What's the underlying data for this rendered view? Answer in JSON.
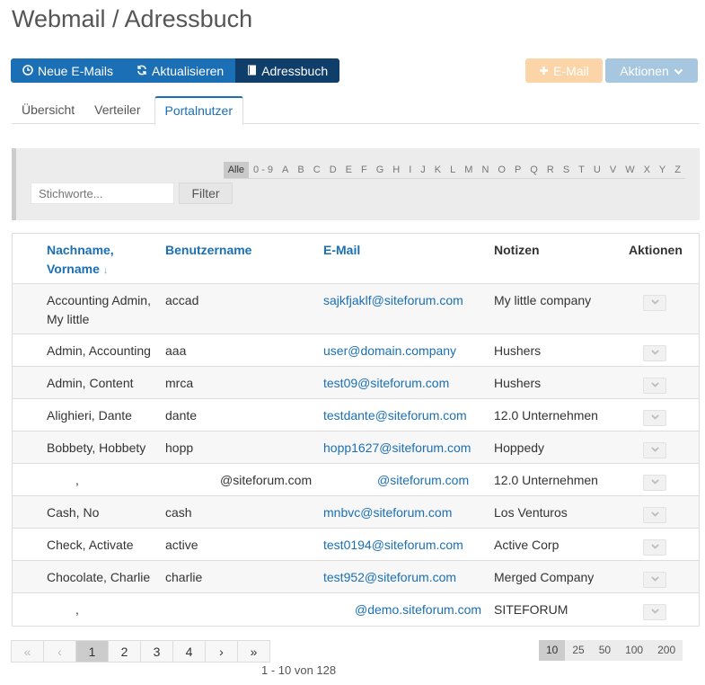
{
  "title": "Webmail / Adressbuch",
  "toolbar": {
    "new_mails": "Neue E-Mails",
    "refresh": "Aktualisieren",
    "addressbook": "Adressbuch",
    "email": "E-Mail",
    "actions": "Aktionen"
  },
  "tabs": [
    "Übersicht",
    "Verteiler",
    "Portalnutzer"
  ],
  "active_tab": "Portalnutzer",
  "alphabet": [
    "Alle",
    "0 - 9",
    "A",
    "B",
    "C",
    "D",
    "E",
    "F",
    "G",
    "H",
    "I",
    "J",
    "K",
    "L",
    "M",
    "N",
    "O",
    "P",
    "Q",
    "R",
    "S",
    "T",
    "U",
    "V",
    "W",
    "X",
    "Y",
    "Z"
  ],
  "search": {
    "placeholder": "Stichworte...",
    "filter_label": "Filter"
  },
  "table": {
    "headers": {
      "name_line1": "Nachname,",
      "name_line2": "Vorname",
      "username": "Benutzername",
      "email": "E-Mail",
      "notes": "Notizen",
      "actions": "Aktionen"
    },
    "rows": [
      {
        "name": "Accounting Admin, My little",
        "username": "accad",
        "email": "sajkfjaklf@siteforum.com",
        "notes": "My little company"
      },
      {
        "name": "Admin, Accounting",
        "username": "aaa",
        "email": "user@domain.company",
        "notes": "Hushers"
      },
      {
        "name": "Admin, Content",
        "username": "mrca",
        "email": "test09@siteforum.com",
        "notes": "Hushers"
      },
      {
        "name": "Alighieri, Dante",
        "username": "dante",
        "email": "testdante@siteforum.com",
        "notes": "12.0 Unternehmen"
      },
      {
        "name": "Bobbety, Hobbety",
        "username": "hopp",
        "email": "hopp1627@siteforum.com",
        "notes": "Hoppedy"
      },
      {
        "name": ",",
        "username": "@siteforum.com",
        "email": "@siteforum.com",
        "notes": "12.0 Unternehmen"
      },
      {
        "name": "Cash, No",
        "username": "cash",
        "email": "mnbvc@siteforum.com",
        "notes": "Los Venturos"
      },
      {
        "name": "Check, Activate",
        "username": "active",
        "email": "test0194@siteforum.com",
        "notes": "Active Corp"
      },
      {
        "name": "Chocolate, Charlie",
        "username": "charlie",
        "email": "test952@siteforum.com",
        "notes": "Merged Company"
      },
      {
        "name": ",",
        "username": "",
        "email": "@demo.siteforum.com",
        "notes": "SITEFORUM"
      }
    ]
  },
  "pagination": {
    "first": "«",
    "prev": "‹",
    "pages": [
      "1",
      "2",
      "3",
      "4"
    ],
    "current": "1",
    "next": "›",
    "last": "»",
    "info": "1 - 10 von 128",
    "sizes": [
      "10",
      "25",
      "50",
      "100",
      "200"
    ],
    "current_size": "10"
  },
  "colors": {
    "primary": "#1a6fb5",
    "active_nav": "#0f3e6b",
    "email_btn": "#fbd5a7",
    "actions_btn": "#a7c7e0"
  }
}
